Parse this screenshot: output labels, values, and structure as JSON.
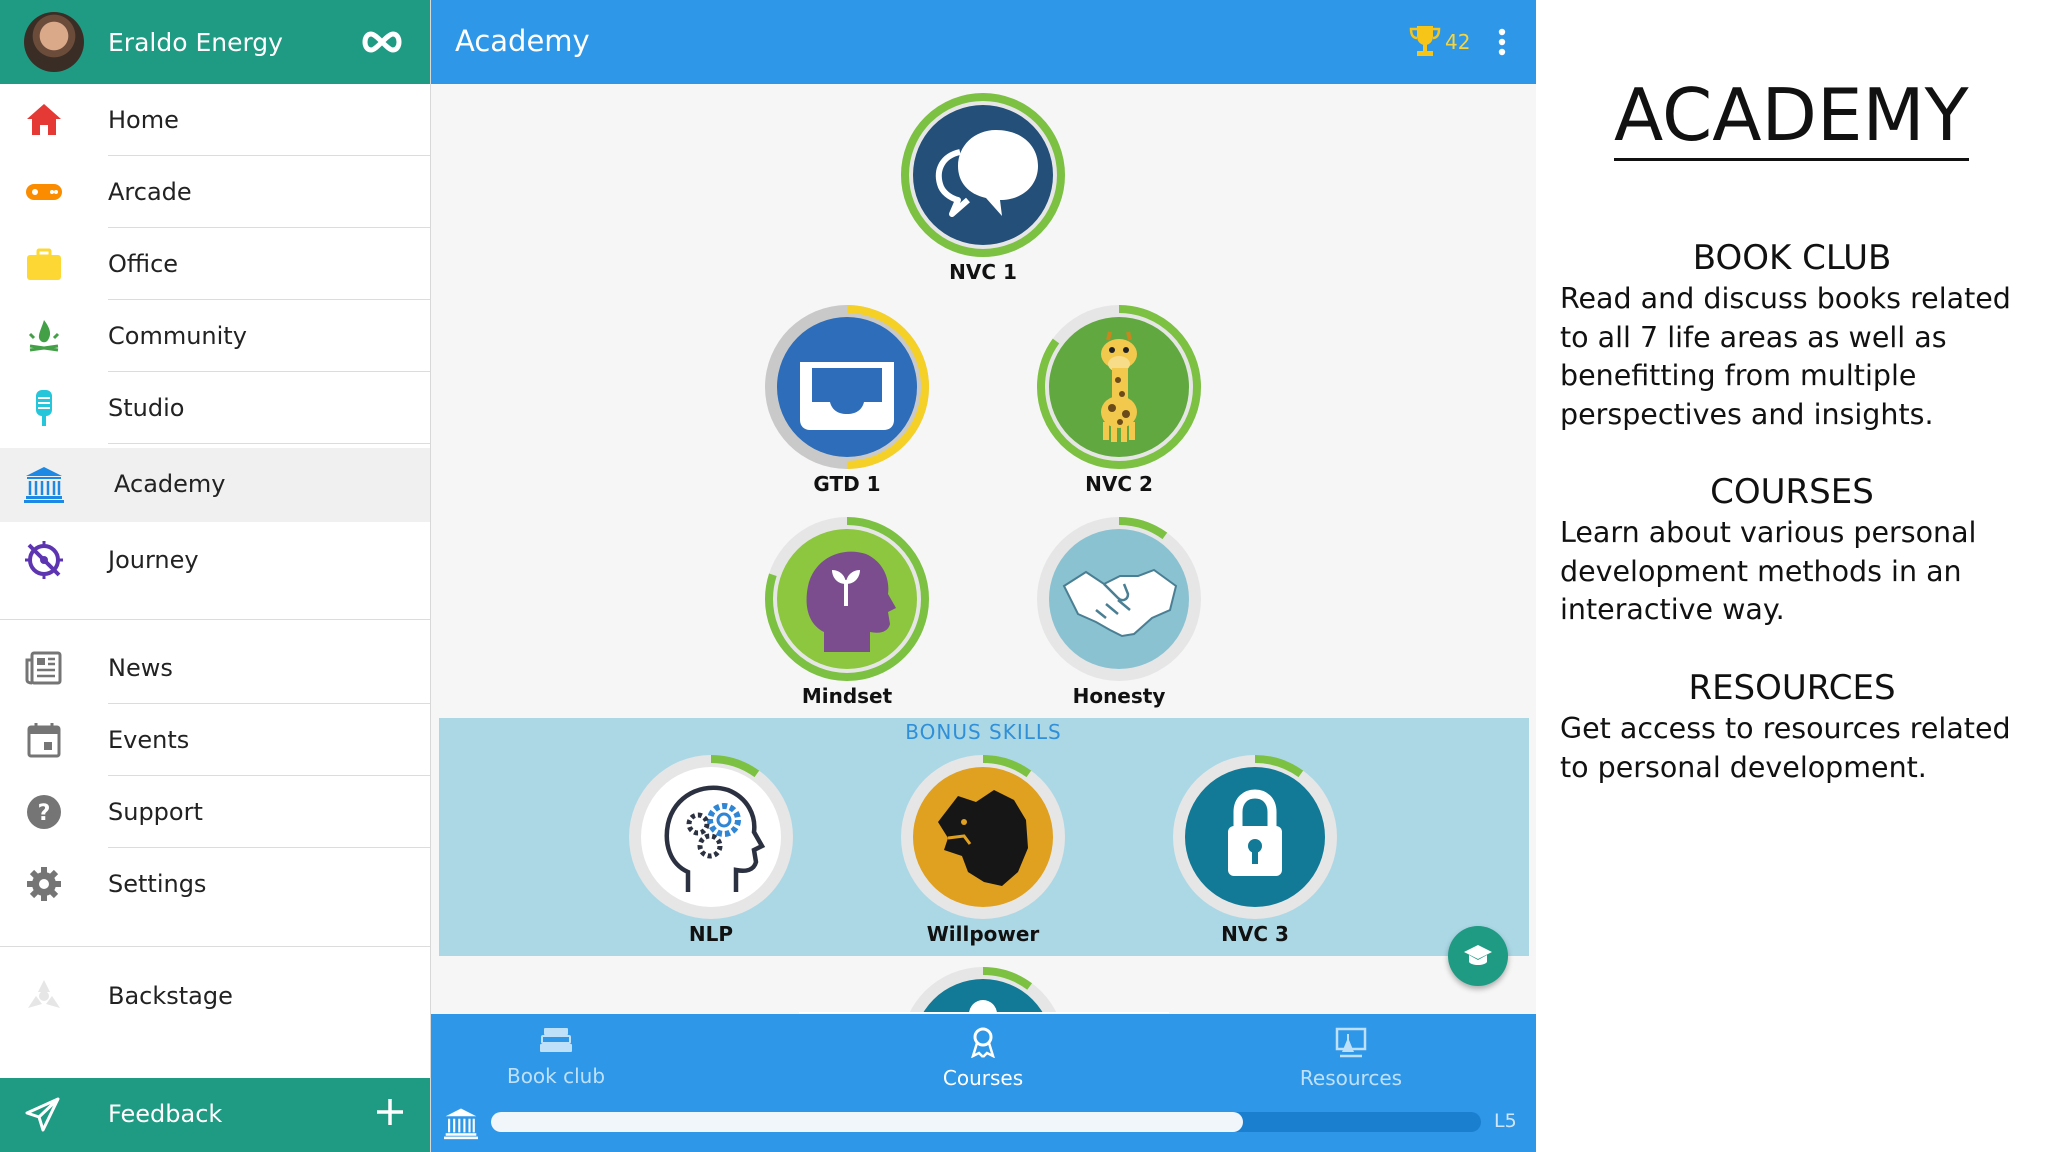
{
  "sidebar": {
    "user_name": "Eraldo Energy",
    "items": [
      {
        "label": "Home",
        "icon": "home-icon",
        "color": "#e53935"
      },
      {
        "label": "Arcade",
        "icon": "gamepad-icon",
        "color": "#fb8c00"
      },
      {
        "label": "Office",
        "icon": "briefcase-icon",
        "color": "#fdd835"
      },
      {
        "label": "Community",
        "icon": "campfire-icon",
        "color": "#43a047"
      },
      {
        "label": "Studio",
        "icon": "microphone-icon",
        "color": "#26c6da"
      },
      {
        "label": "Academy",
        "icon": "institution-icon",
        "color": "#1e88e5",
        "active": true
      },
      {
        "label": "Journey",
        "icon": "compass-icon",
        "color": "#5e35b1"
      },
      {
        "label": "News",
        "icon": "newspaper-icon",
        "color": "#757575"
      },
      {
        "label": "Events",
        "icon": "calendar-icon",
        "color": "#757575"
      },
      {
        "label": "Support",
        "icon": "help-icon",
        "color": "#757575"
      },
      {
        "label": "Settings",
        "icon": "gear-icon",
        "color": "#757575"
      },
      {
        "label": "Backstage",
        "icon": "clapper-icon",
        "color": "#e0e0e0"
      }
    ],
    "feedback_label": "Feedback"
  },
  "header": {
    "title": "Academy",
    "trophy_count": "42"
  },
  "skills": [
    {
      "name": "NVC 1",
      "icon": "speech-bubbles-icon",
      "progress": 1.0
    },
    {
      "name": "GTD 1",
      "icon": "inbox-tray-icon",
      "progress": 0.5
    },
    {
      "name": "NVC 2",
      "icon": "giraffe-icon",
      "progress": 0.85
    },
    {
      "name": "Mindset",
      "icon": "head-sprout-icon",
      "progress": 0.8
    },
    {
      "name": "Honesty",
      "icon": "handshake-icon",
      "progress": 0.1
    }
  ],
  "bonus": {
    "title": "BONUS SKILLS",
    "skills": [
      {
        "name": "NLP",
        "icon": "brain-gears-icon",
        "progress": 0.1
      },
      {
        "name": "Willpower",
        "icon": "lion-icon",
        "progress": 0.1
      },
      {
        "name": "NVC 3",
        "icon": "padlock-icon",
        "progress": 0.1
      }
    ]
  },
  "tabs": [
    {
      "label": "Book club",
      "icon": "books-icon"
    },
    {
      "label": "Courses",
      "icon": "award-icon",
      "active": true
    },
    {
      "label": "Resources",
      "icon": "flask-board-icon"
    }
  ],
  "progress": {
    "fraction": 0.76,
    "level": "L5"
  },
  "info": {
    "title": "ACADEMY",
    "sections": [
      {
        "heading": "BOOK CLUB",
        "lines": [
          "Read and discuss books related",
          "to all 7 life areas as well as",
          "benefitting from multiple",
          "perspectives and insights."
        ]
      },
      {
        "heading": "COURSES",
        "lines": [
          "Learn about various personal",
          "development methods in an",
          "interactive way."
        ]
      },
      {
        "heading": "RESOURCES",
        "lines": [
          "Get access to resources related",
          "to personal development."
        ]
      }
    ]
  }
}
